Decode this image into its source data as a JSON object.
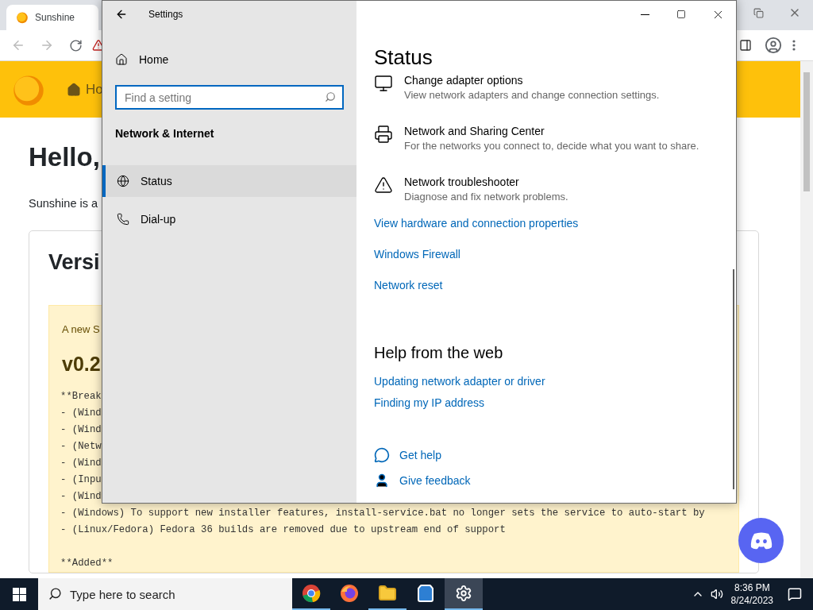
{
  "browser": {
    "tab": {
      "title": "Sunshine"
    },
    "nav": {
      "home_label": "Ho"
    },
    "page": {
      "heading": "Hello,",
      "intro": "Sunshine is a",
      "card_title": "Versi",
      "alert": {
        "text": "A new S",
        "version": "v0.2",
        "notes": [
          "**Break",
          "- (Wind",
          "- (Wind",
          "- (Netw",
          "- (Wind",
          "- (Inpu",
          "- (Wind",
          "- (Windows) To support new installer features, install-service.bat no longer sets the service to auto-start by",
          "- (Linux/Fedora) Fedora 36 builds are removed due to upstream end of support",
          "**Added**"
        ]
      }
    }
  },
  "settings_window": {
    "title": "Settings",
    "sidebar": {
      "home": "Home",
      "search": {
        "placeholder": "Find a setting"
      },
      "section": "Network & Internet",
      "items": [
        {
          "label": "Status",
          "kind": "globe",
          "selected": true
        },
        {
          "label": "Dial-up",
          "kind": "phone",
          "selected": false
        }
      ]
    },
    "main": {
      "title": "Status",
      "options": [
        {
          "kind": "monitor",
          "title": "Change adapter options",
          "description": "View network adapters and change connection settings."
        },
        {
          "kind": "printer",
          "title": "Network and Sharing Center",
          "description": "For the networks you connect to, decide what you want to share."
        },
        {
          "kind": "warning",
          "title": "Network troubleshooter",
          "description": "Diagnose and fix network problems."
        }
      ],
      "links": [
        "View hardware and connection properties",
        "Windows Firewall",
        "Network reset"
      ],
      "help_heading": "Help from the web",
      "help_links": [
        "Updating network adapter or driver",
        "Finding my IP address"
      ],
      "support": [
        {
          "kind": "chat",
          "label": "Get help"
        },
        {
          "kind": "person",
          "label": "Give feedback"
        }
      ]
    }
  },
  "taskbar": {
    "search": {
      "placeholder": "Type here to search"
    },
    "apps": [
      {
        "kind": "chrome",
        "running": true,
        "selected": false
      },
      {
        "kind": "firefox",
        "running": false,
        "selected": false
      },
      {
        "kind": "folder",
        "running": true,
        "selected": false
      },
      {
        "kind": "store",
        "running": false,
        "selected": false
      },
      {
        "kind": "gear",
        "running": true,
        "selected": true
      }
    ],
    "clock": {
      "time": "8:36 PM",
      "date": "8/24/2023"
    }
  }
}
